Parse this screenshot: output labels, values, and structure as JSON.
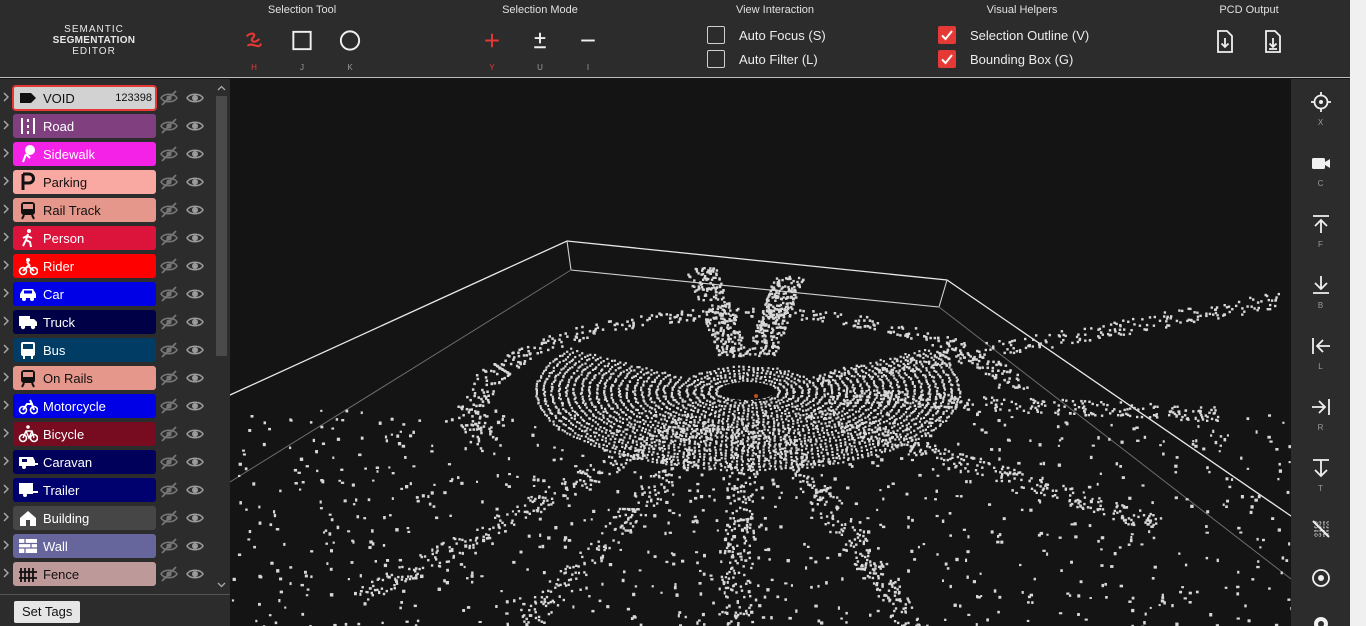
{
  "app": {
    "logo_line1": "SEMANTIC",
    "logo_line2": "SEGMENTATION",
    "logo_line3": "EDITOR"
  },
  "toolbar": {
    "selection_tool": {
      "title": "Selection Tool",
      "tools": [
        {
          "icon": "lasso-icon",
          "key": "H",
          "active": true
        },
        {
          "icon": "rectangle-icon",
          "key": "J",
          "active": false
        },
        {
          "icon": "circle-icon",
          "key": "K",
          "active": false
        }
      ]
    },
    "selection_mode": {
      "title": "Selection Mode",
      "modes": [
        {
          "icon": "plus-icon",
          "key": "Y",
          "active": true
        },
        {
          "icon": "plus-minus-icon",
          "key": "U",
          "active": false
        },
        {
          "icon": "minus-icon",
          "key": "I",
          "active": false
        }
      ]
    },
    "view_interaction": {
      "title": "View Interaction",
      "options": [
        {
          "label": "Auto Focus (S)",
          "checked": false
        },
        {
          "label": "Auto Filter (L)",
          "checked": false
        }
      ]
    },
    "visual_helpers": {
      "title": "Visual Helpers",
      "options": [
        {
          "label": "Selection Outline (V)",
          "checked": true
        },
        {
          "label": "Bounding Box (G)",
          "checked": true
        }
      ]
    },
    "pcd_output": {
      "title": "PCD Output",
      "buttons": [
        {
          "icon": "file-download-icon"
        },
        {
          "icon": "file-download-alt-icon"
        }
      ]
    }
  },
  "sidebar": {
    "tags": [
      {
        "label": "VOID",
        "count": "123398",
        "color": "#d2d2d2",
        "text_color": "#111111",
        "icon": "tag-icon",
        "selected": true
      },
      {
        "label": "Road",
        "color": "#80407f",
        "text_color": "#ffffff",
        "icon": "road-icon"
      },
      {
        "label": "Sidewalk",
        "color": "#f422e6",
        "text_color": "#ffffff",
        "icon": "pedestrian-sign-icon"
      },
      {
        "label": "Parking",
        "color": "#f9a9a1",
        "text_color": "#111111",
        "icon": "parking-icon"
      },
      {
        "label": "Rail Track",
        "color": "#e6978c",
        "text_color": "#111111",
        "icon": "train-icon"
      },
      {
        "label": "Person",
        "color": "#dc143c",
        "text_color": "#ffffff",
        "icon": "walking-person-icon"
      },
      {
        "label": "Rider",
        "color": "#ff0000",
        "text_color": "#ffffff",
        "icon": "motorcycle-rider-icon"
      },
      {
        "label": "Car",
        "color": "#0000e6",
        "text_color": "#ffffff",
        "icon": "car-icon"
      },
      {
        "label": "Truck",
        "color": "#000046",
        "text_color": "#ffffff",
        "icon": "truck-icon"
      },
      {
        "label": "Bus",
        "color": "#003c64",
        "text_color": "#ffffff",
        "icon": "bus-icon"
      },
      {
        "label": "On Rails",
        "color": "#e6978c",
        "text_color": "#111111",
        "icon": "train-icon"
      },
      {
        "label": "Motorcycle",
        "color": "#0000e6",
        "text_color": "#ffffff",
        "icon": "motorcycle-icon"
      },
      {
        "label": "Bicycle",
        "color": "#770b20",
        "text_color": "#ffffff",
        "icon": "bicycle-icon"
      },
      {
        "label": "Caravan",
        "color": "#00005a",
        "text_color": "#ffffff",
        "icon": "caravan-icon"
      },
      {
        "label": "Trailer",
        "color": "#00006e",
        "text_color": "#ffffff",
        "icon": "trailer-icon"
      },
      {
        "label": "Building",
        "color": "#464646",
        "text_color": "#ffffff",
        "icon": "house-icon"
      },
      {
        "label": "Wall",
        "color": "#66669c",
        "text_color": "#ffffff",
        "icon": "brick-wall-icon"
      },
      {
        "label": "Fence",
        "color": "#be9999",
        "text_color": "#111111",
        "icon": "fence-icon"
      }
    ],
    "set_tags_label": "Set Tags"
  },
  "view_buttons": [
    {
      "icon": "crosshair-icon",
      "key": "X"
    },
    {
      "icon": "camera-icon",
      "key": "C"
    },
    {
      "icon": "arrow-up-to-line-icon",
      "key": "F"
    },
    {
      "icon": "arrow-down-to-line-icon",
      "key": "B"
    },
    {
      "icon": "arrow-left-to-line-icon",
      "key": "L"
    },
    {
      "icon": "arrow-right-to-line-icon",
      "key": "R"
    },
    {
      "icon": "arrow-down-from-line-icon",
      "key": "T"
    },
    {
      "icon": "grid-slash-icon",
      "key": ""
    },
    {
      "icon": "target-dot-icon",
      "key": ""
    },
    {
      "icon": "settings-icon",
      "key": ""
    }
  ],
  "colors": {
    "accent": "#e53935",
    "toolbar_bg": "#2c2c2c",
    "viewport_bg": "#141414",
    "points": "#d8d8d8"
  }
}
